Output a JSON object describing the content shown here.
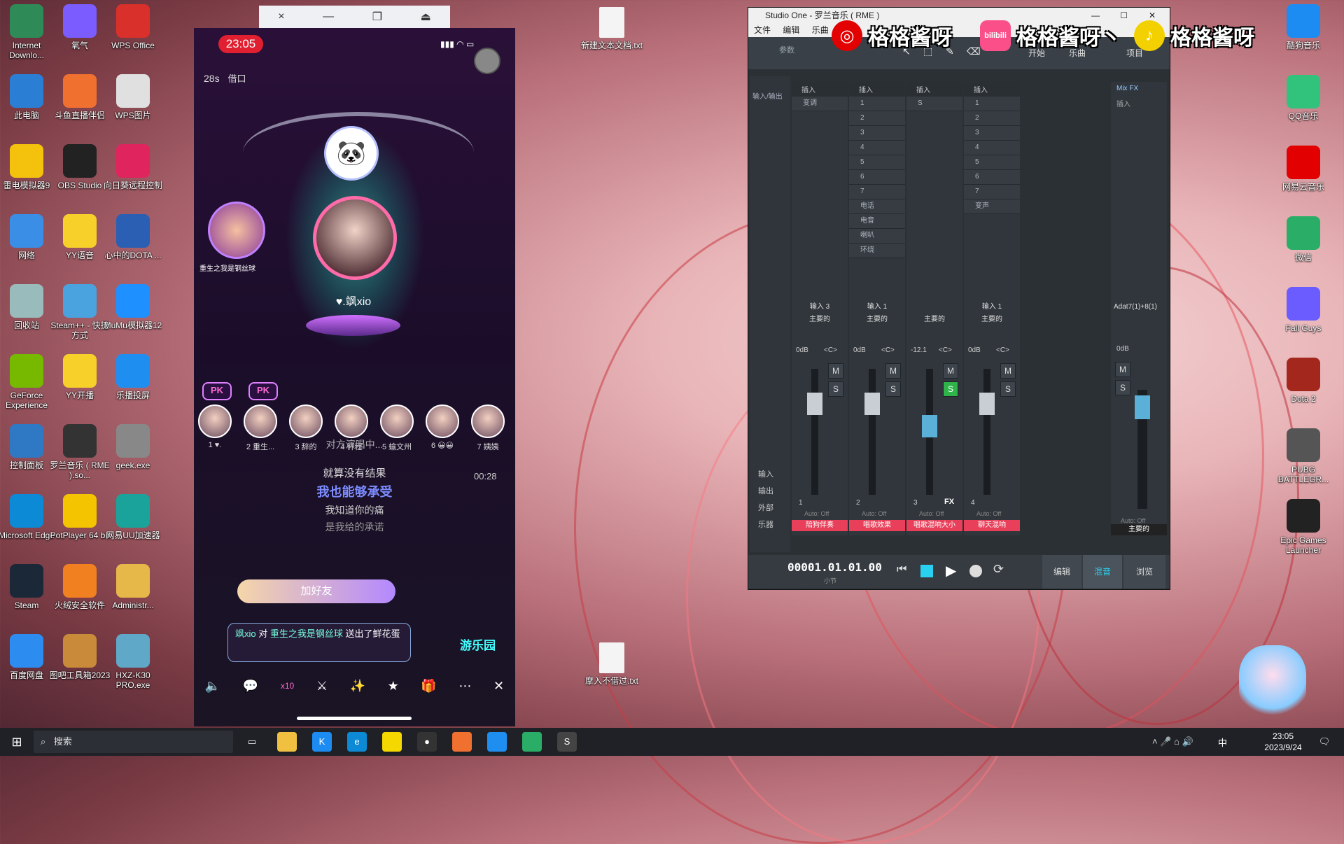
{
  "desktop_left": [
    {
      "label": "Internet Downlo...",
      "icon": "internet-download-icon",
      "color": "#2e8b57"
    },
    {
      "label": "氧气",
      "icon": "oxygen-icon",
      "color": "#7b5cff"
    },
    {
      "label": "WPS Office",
      "icon": "wps-office-icon",
      "color": "#d9302c"
    },
    {
      "label": "此电脑",
      "icon": "this-pc-icon",
      "color": "#2a7fd4"
    },
    {
      "label": "斗鱼直播伴侣",
      "icon": "douyu-icon",
      "color": "#f07030"
    },
    {
      "label": "WPS图片",
      "icon": "wps-picture-icon",
      "color": "#e0e0e0"
    },
    {
      "label": "雷电模拟器9",
      "icon": "ldplayer-icon",
      "color": "#f4c20d"
    },
    {
      "label": "OBS Studio",
      "icon": "obs-icon",
      "color": "#222"
    },
    {
      "label": "向日葵远程控制",
      "icon": "sunflower-icon",
      "color": "#e0245e"
    },
    {
      "label": "网络",
      "icon": "network-icon",
      "color": "#3a8ee6"
    },
    {
      "label": "YY语音",
      "icon": "yy-icon",
      "color": "#f7d12a"
    },
    {
      "label": "心中的DOTA ...",
      "icon": "word-doc-icon",
      "color": "#2b5fb3"
    },
    {
      "label": "回收站",
      "icon": "recycle-bin-icon",
      "color": "#9bb"
    },
    {
      "label": "Steam++ - 快捷方式",
      "icon": "steam-plus-icon",
      "color": "#4aa3df"
    },
    {
      "label": "MuMu模拟器12",
      "icon": "mumu-icon",
      "color": "#1e90ff"
    },
    {
      "label": "GeForce Experience",
      "icon": "geforce-icon",
      "color": "#76b900"
    },
    {
      "label": "YY开播",
      "icon": "yy-live-icon",
      "color": "#f7d12a"
    },
    {
      "label": "乐播投屏",
      "icon": "lebo-icon",
      "color": "#1f8ef1"
    },
    {
      "label": "控制面板",
      "icon": "control-panel-icon",
      "color": "#2f79c4"
    },
    {
      "label": "罗兰音乐 ( RME ).so...",
      "icon": "studio-one-icon",
      "color": "#333"
    },
    {
      "label": "geek.exe",
      "icon": "geek-icon",
      "color": "#888"
    },
    {
      "label": "Microsoft Edge",
      "icon": "edge-icon",
      "color": "#0c8ad6"
    },
    {
      "label": "PotPlayer 64 bit",
      "icon": "potplayer-icon",
      "color": "#f5c400"
    },
    {
      "label": "网易UU加速器",
      "icon": "uu-icon",
      "color": "#1aa39a"
    },
    {
      "label": "Steam",
      "icon": "steam-icon",
      "color": "#1b2838"
    },
    {
      "label": "火绒安全软件",
      "icon": "huorong-icon",
      "color": "#f08020"
    },
    {
      "label": "Administr...",
      "icon": "user-folder-icon",
      "color": "#e6b84a"
    },
    {
      "label": "百度网盘",
      "icon": "baidu-netdisk-icon",
      "color": "#2d8cf0"
    },
    {
      "label": "图吧工具箱2023",
      "icon": "tuba-toolbox-icon",
      "color": "#c98a3a"
    },
    {
      "label": "HXZ-K30 PRO.exe",
      "icon": "hxz-icon",
      "color": "#5fa8c8"
    }
  ],
  "desktop_right": [
    {
      "label": "酷狗音乐",
      "icon": "kugou-icon",
      "color": "#1c8cf2"
    },
    {
      "label": "QQ音乐",
      "icon": "qqmusic-icon",
      "color": "#31c27c"
    },
    {
      "label": "网易云音乐",
      "icon": "netease-music-icon",
      "color": "#e20000"
    },
    {
      "label": "微信",
      "icon": "wechat-icon",
      "color": "#2aae67"
    },
    {
      "label": "Fall Guys",
      "icon": "fallguys-icon",
      "color": "#6a5cff"
    },
    {
      "label": "Dota 2",
      "icon": "dota2-icon",
      "color": "#a3271d"
    },
    {
      "label": "PUBG BATTLEGR...",
      "icon": "pubg-icon",
      "color": "#555"
    },
    {
      "label": "Epic Games Launcher",
      "icon": "epic-icon",
      "color": "#222"
    }
  ],
  "desktop_mid": [
    {
      "label": "新建文本文档.txt",
      "icon": "text-file-icon"
    },
    {
      "label": "摩入不借过.txt",
      "icon": "text-file-icon"
    }
  ],
  "phone": {
    "time": "23:05",
    "timer": "28s",
    "song_tag": "借口",
    "host_name": "♥.飒xio",
    "side_user": "重生之我是钢丝球",
    "pk": "PK",
    "seats": [
      {
        "num": "1",
        "name": "♥."
      },
      {
        "num": "2",
        "name": "重生..."
      },
      {
        "num": "3",
        "name": "辞的"
      },
      {
        "num": "4",
        "name": "钎程"
      },
      {
        "num": "5",
        "name": "蝓文州"
      },
      {
        "num": "6",
        "name": "😀😀"
      },
      {
        "num": "7",
        "name": "姨姨"
      }
    ],
    "status": "对方演唱中...",
    "lyrics": [
      "就算没有结果",
      "我也能够承受",
      "我知道你的痛",
      "是我给的承诺"
    ],
    "lyric_time": "00:28",
    "add_friend": "加好友",
    "gift_msg_user": "飒xio",
    "gift_msg_mid": "对",
    "gift_msg_target": "重生之我是钢丝球",
    "gift_msg_tail": "送出了鲜花蛋",
    "park": "游乐园",
    "toolbar_x10": "x10"
  },
  "phone_window": {
    "close": "×",
    "min": "—",
    "restore": "❐",
    "eject": "⏏"
  },
  "daw": {
    "title": "Studio One - 罗兰音乐 ( RME )",
    "menu": [
      "文件",
      "编辑",
      "乐曲"
    ],
    "params": "参数",
    "top_buttons": [
      "开始",
      "乐曲",
      "项目"
    ],
    "insert": "插入",
    "mixfx": "Mix FX",
    "input_label": "输入/输出",
    "ch1_slots": [
      "变调"
    ],
    "ch2_slots": [
      "1",
      "2",
      "3",
      "4",
      "5",
      "6",
      "7",
      "电话",
      "电音",
      "喇叭",
      "环绕"
    ],
    "ch3_slots": [
      "S"
    ],
    "ch4_slots": [
      "1",
      "2",
      "3",
      "4",
      "5",
      "6",
      "7",
      "变声"
    ],
    "ch_inputs": [
      "输入 3",
      "输入 1",
      "",
      "输入 1"
    ],
    "ch_main": "主要的",
    "ch_db": [
      "0dB",
      "0dB",
      "-12.1",
      "0dB"
    ],
    "pan": "<C>",
    "mute": "M",
    "solo": "S",
    "ch_nums": [
      "1",
      "2",
      "3",
      "4"
    ],
    "auto": "Auto: Off",
    "ch_names": [
      "陪狗伴奏",
      "唱歌效果",
      "唱歌混响大小",
      "聊天混响"
    ],
    "side_labels": [
      "输入",
      "输出",
      "外部",
      "乐器"
    ],
    "fx": "FX",
    "bus_name": "Adat7(1)+8(1)",
    "bus_db": "0dB",
    "position": "00001.01.01.00",
    "position_unit": "小节",
    "bottom_tabs": [
      "编辑",
      "混音",
      "浏览"
    ]
  },
  "banner": {
    "name1": "格格酱呀",
    "name2": "格格酱呀丶",
    "name3": "格格酱呀",
    "bili": "bilibili"
  },
  "taskbar": {
    "search": "搜索",
    "time": "23:05",
    "date": "2023/9/24",
    "ime": "中"
  }
}
